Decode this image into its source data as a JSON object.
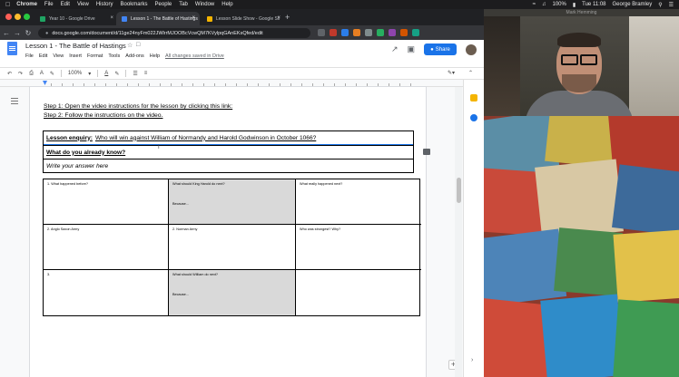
{
  "menubar": {
    "app_name": "Chrome",
    "items": [
      "File",
      "Edit",
      "View",
      "History",
      "Bookmarks",
      "People",
      "Tab",
      "Window",
      "Help"
    ],
    "battery": "100%",
    "clock": "Tue 11:08",
    "user": "George Bramley"
  },
  "browser": {
    "tabs": [
      {
        "title": "Year 10 - Google Drive",
        "color": "#1fa463"
      },
      {
        "title": "Lesson 1 - The Battle of Hastings",
        "color": "#4285f4"
      },
      {
        "title": "Lesson Slide Show - Google Sli",
        "color": "#f4b400"
      }
    ],
    "url": "docs.google.com/document/d/11ge24nyFm022JWlrrMJOOBcVcwQM7KVylpqGAnEKsQfed/edit"
  },
  "docs": {
    "title": "Lesson 1 - The Battle of Hastings",
    "menus": [
      "File",
      "Edit",
      "View",
      "Insert",
      "Format",
      "Tools",
      "Add-ons",
      "Help"
    ],
    "saved_status": "All changes saved in Drive",
    "share_label": "Share",
    "zoom": "100%",
    "step1": "Step 1: Open the video instructions for the lesson by clicking this link:",
    "step2": "Step 2: Follow the instructions on the video.",
    "enquiry_label": "Lesson enquiry:",
    "enquiry_text": "Who will win against William of Normandy and Harold Godwinson in October 1066?",
    "know_label": "What do you already know?",
    "answer_placeholder": "Write your answer here",
    "grid": [
      {
        "text": "1. What happened before?",
        "sub": ""
      },
      {
        "text": "What should King Harold do next?",
        "sub": "Because..."
      },
      {
        "text": "What really happened next?",
        "sub": ""
      },
      {
        "text": "2. Anglo Saxon Army",
        "sub": ""
      },
      {
        "text": "2. Norman Army",
        "sub": ""
      },
      {
        "text": "Who was strongest? Why?",
        "sub": ""
      },
      {
        "text": "3.",
        "sub": ""
      },
      {
        "text": "What should William do next?",
        "sub": "Because..."
      },
      {
        "text": "",
        "sub": ""
      }
    ]
  },
  "webcam": {
    "name": "Mark Hemming"
  },
  "colors": {
    "accent": "#1a73e8",
    "grey_cell": "#d9d9d9"
  }
}
